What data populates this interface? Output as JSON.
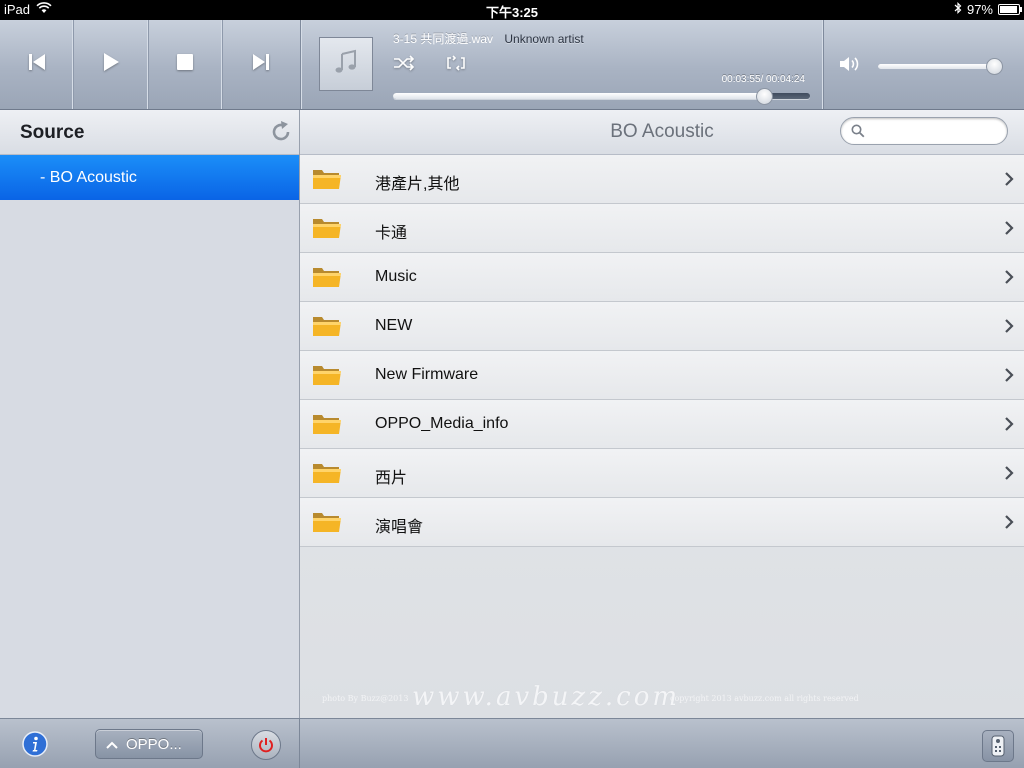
{
  "status_bar": {
    "device": "iPad",
    "time": "下午3:25",
    "battery": "97%",
    "battery_level": 0.97
  },
  "player": {
    "track_title": "3-15 共同渡過.wav",
    "artist": "Unknown artist",
    "time_readout": "00:03:55/ 00:04:24",
    "progress": 0.89,
    "volume": 0.98
  },
  "sidebar": {
    "title": "Source",
    "items": [
      {
        "label": "- BO Acoustic",
        "selected": true
      }
    ]
  },
  "main": {
    "title": "BO Acoustic",
    "search": {
      "placeholder": "",
      "value": ""
    },
    "items": [
      {
        "label": "港產片,其他"
      },
      {
        "label": "卡通"
      },
      {
        "label": "Music"
      },
      {
        "label": "NEW"
      },
      {
        "label": "New Firmware"
      },
      {
        "label": "OPPO_Media_info"
      },
      {
        "label": "西片"
      },
      {
        "label": "演唱會"
      }
    ]
  },
  "watermark": {
    "left": "photo By Buzz@2013",
    "center": "www.avbuzz.com",
    "right": "copyright 2013 avbuzz.com all rights reserved"
  },
  "bottom": {
    "device_label": "OPPO..."
  },
  "colors": {
    "selection_blue": "#0a64e6",
    "toolbar_gray": "#a9b3c3",
    "folder_orange": "#f5b526"
  }
}
